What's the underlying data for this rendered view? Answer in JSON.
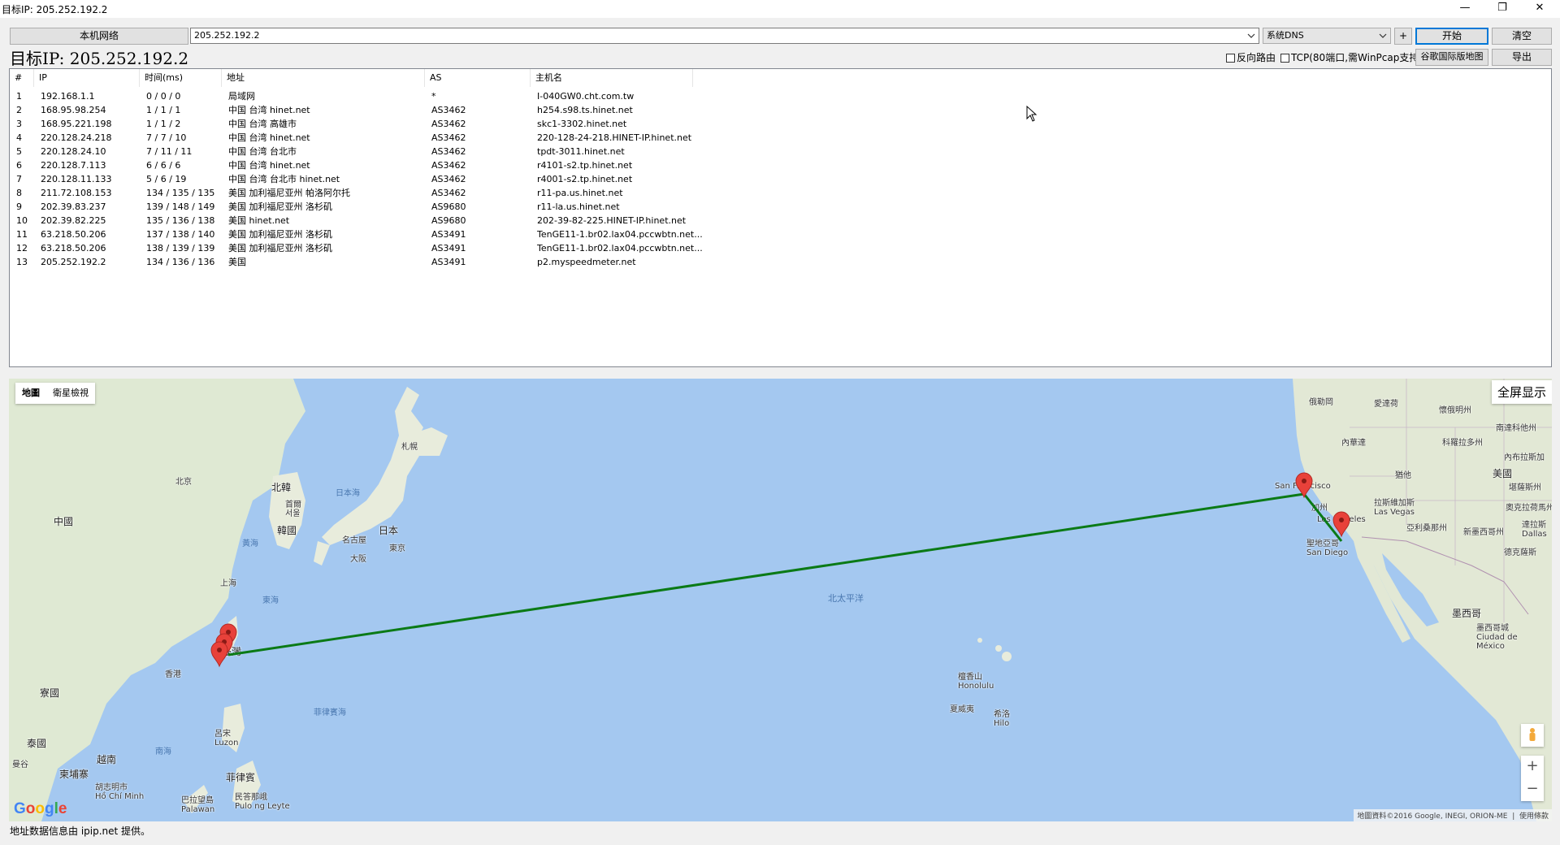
{
  "window": {
    "title": "目标IP: 205.252.192.2",
    "minimize": "—",
    "restore": "❐",
    "close": "✕"
  },
  "toolbar": {
    "local_network_btn": "本机网络",
    "target_input": "205.252.192.2",
    "dns_select": "系统DNS",
    "add_btn": "+",
    "start_btn": "开始",
    "clear_btn": "清空",
    "reverse_route": "反向路由",
    "tcp_option": "TCP(80端口,需WinPcap支持)",
    "google_map_btn": "谷歌国际版地图",
    "export_btn": "导出"
  },
  "target_display": "目标IP: 205.252.192.2",
  "table": {
    "headers": [
      "#",
      "IP",
      "时间(ms)",
      "地址",
      "AS",
      "主机名"
    ],
    "rows": [
      [
        "1",
        "192.168.1.1",
        "0 / 0 / 0",
        "局域网",
        "*",
        "I-040GW0.cht.com.tw"
      ],
      [
        "2",
        "168.95.98.254",
        "1 / 1 / 1",
        "中国 台湾 hinet.net",
        "AS3462",
        "h254.s98.ts.hinet.net"
      ],
      [
        "3",
        "168.95.221.198",
        "1 / 1 / 2",
        "中国 台湾 高雄市",
        "AS3462",
        "skc1-3302.hinet.net"
      ],
      [
        "4",
        "220.128.24.218",
        "7 / 7 / 10",
        "中国 台湾 hinet.net",
        "AS3462",
        "220-128-24-218.HINET-IP.hinet.net"
      ],
      [
        "5",
        "220.128.24.10",
        "7 / 11 / 11",
        "中国 台湾 台北市",
        "AS3462",
        "tpdt-3011.hinet.net"
      ],
      [
        "6",
        "220.128.7.113",
        "6 / 6 / 6",
        "中国 台湾 hinet.net",
        "AS3462",
        "r4101-s2.tp.hinet.net"
      ],
      [
        "7",
        "220.128.11.133",
        "5 / 6 / 19",
        "中国 台湾 台北市 hinet.net",
        "AS3462",
        "r4001-s2.tp.hinet.net"
      ],
      [
        "8",
        "211.72.108.153",
        "134 / 135 / 135",
        "美国 加利福尼亚州 帕洛阿尔托",
        "AS3462",
        "r11-pa.us.hinet.net"
      ],
      [
        "9",
        "202.39.83.237",
        "139 / 148 / 149",
        "美国 加利福尼亚州 洛杉矶",
        "AS9680",
        "r11-la.us.hinet.net"
      ],
      [
        "10",
        "202.39.82.225",
        "135 / 136 / 138",
        "美国 hinet.net",
        "AS9680",
        "202-39-82-225.HINET-IP.hinet.net"
      ],
      [
        "11",
        "63.218.50.206",
        "137 / 138 / 140",
        "美国 加利福尼亚州 洛杉矶",
        "AS3491",
        "TenGE11-1.br02.lax04.pccwbtn.net..."
      ],
      [
        "12",
        "63.218.50.206",
        "138 / 139 / 139",
        "美国 加利福尼亚州 洛杉矶",
        "AS3491",
        "TenGE11-1.br02.lax04.pccwbtn.net..."
      ],
      [
        "13",
        "205.252.192.2",
        "134 / 136 / 136",
        "美国",
        "AS3491",
        "p2.myspeedmeter.net"
      ]
    ]
  },
  "map": {
    "type_map": "地圖",
    "type_satellite": "衛星檢視",
    "fullscreen": "全屏显示",
    "zoom_in": "+",
    "zoom_out": "−",
    "attribution": "地圖資料©2016 Google, INEGI, ORION-ME",
    "terms": "使用條款",
    "logo": "Google",
    "route_color": "#0b7a16",
    "marker_color": "#e8413a",
    "labels": {
      "china": "中國",
      "beijing": "北京",
      "north_korea": "北韓",
      "south_korea": "韓國",
      "seoul": "首爾\n서울",
      "japan_sea": "日本海",
      "sapporo": "札幌",
      "japan": "日本",
      "tokyo": "東京",
      "nagoya": "名古屋",
      "osaka": "大阪",
      "yellow_sea": "黃海",
      "shanghai": "上海",
      "east_sea": "東海",
      "hong_kong": "香港",
      "taiwan": "臺灣",
      "laos": "寮國",
      "vietnam": "越南",
      "thailand": "泰國",
      "bangkok": "曼谷",
      "cambodia": "柬埔寨",
      "hcmc": "胡志明市\nHồ Chí Minh",
      "south_sea": "南海",
      "philippine_sea": "菲律賓海",
      "luzon": "呂宋\nLuzon",
      "philippines": "菲律賓",
      "palawan": "巴拉望島\nPalawan",
      "pulo_ng_leyte": "民答那峨\nPulo ng Leyte",
      "north_pacific": "北太平洋",
      "honolulu": "檀香山\nHonolulu",
      "hawaii": "夏威夷",
      "hilo": "希洛\nHilo",
      "oregon": "俄勒岡",
      "idaho": "愛達荷",
      "wyoming": "懷俄明州",
      "nevada": "內華達",
      "utah": "猶他",
      "california": "加州",
      "arizona": "亞利桑那州",
      "new_mexico": "新墨西哥州",
      "usa": "美國",
      "las_vegas": "拉斯維加斯\nLas Vegas",
      "san_francisco": "San Francisco",
      "los_angeles": "Los Angeles",
      "san_diego": "聖地亞哥\nSan Diego",
      "mexico": "墨西哥",
      "mexico_city": "墨西哥城\nCiudad de\nMéxico",
      "dallas": "達拉斯\nDallas",
      "texas": "德克薩斯",
      "nebraska": "內布拉斯加",
      "colorado": "科羅拉多州",
      "kansas": "堪薩斯州",
      "oklahoma": "奧克拉荷馬州",
      "south_dakota": "南達科他州"
    }
  },
  "status_text": "地址数据信息由 ipip.net 提供。"
}
